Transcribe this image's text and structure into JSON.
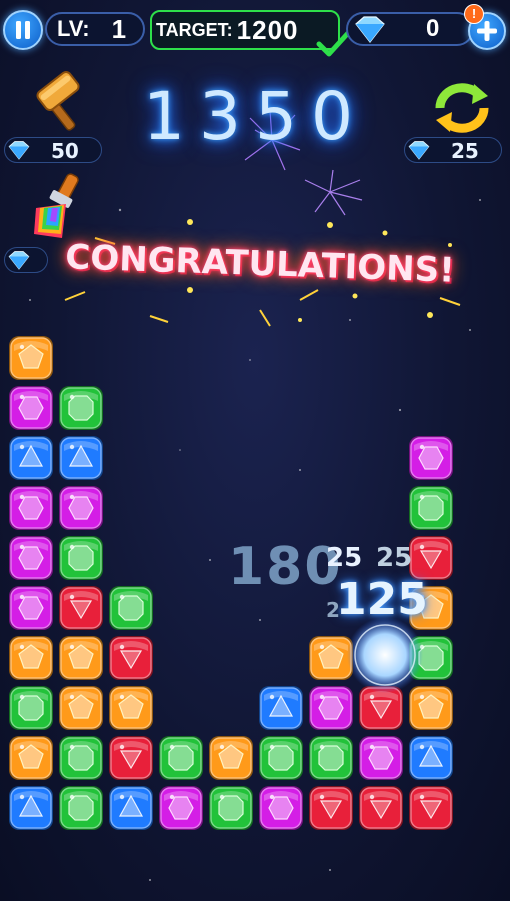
{
  "hud": {
    "level_label": "LV:",
    "level_value": "1",
    "target_label": "TARGET:",
    "target_value": "1200",
    "diamond_count": "0",
    "notification_badge": "!"
  },
  "score": "1350",
  "powerups": {
    "hammer_cost": "50",
    "refresh_cost": "25"
  },
  "message": "CONGRATULATIONS!",
  "floating_points": {
    "big": "180",
    "small_a": "25",
    "small_b": "25",
    "medium": "125",
    "tiny": "2"
  },
  "colors": {
    "orange": "#ff9a1a",
    "magenta": "#d41ee6",
    "green": "#22c23a",
    "blue": "#1f7bff",
    "red": "#e8203a"
  },
  "board": {
    "columns": [
      [
        "blue",
        "orange",
        "green",
        "orange",
        "magenta",
        "magenta",
        "magenta",
        "blue",
        "magenta",
        "orange"
      ],
      [
        "green",
        "green",
        "orange",
        "orange",
        "red",
        "green",
        "magenta",
        "blue",
        "green"
      ],
      [
        "blue",
        "red",
        "orange",
        "red",
        "green"
      ],
      [
        "magenta",
        "green"
      ],
      [
        "green",
        "orange"
      ],
      [
        "magenta",
        "green",
        "blue"
      ],
      [
        "red",
        "green",
        "magenta",
        "orange"
      ],
      [
        "red",
        "magenta",
        "red"
      ],
      [
        "red",
        "blue",
        "orange",
        "green",
        "orange",
        "red",
        "green",
        "magenta"
      ]
    ]
  }
}
